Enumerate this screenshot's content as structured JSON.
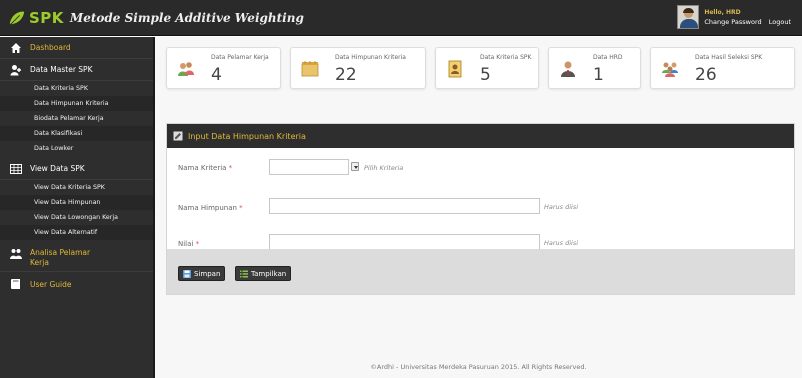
{
  "header": {
    "brand_spk": "SPK",
    "brand_rest": "Metode Simple Additive Weighting",
    "greeting": "Hello, HRD",
    "change_password": "Change Password",
    "logout": "Logout"
  },
  "sidebar": {
    "items": [
      {
        "label": "Dashboard",
        "icon": "home-icon",
        "active": true
      },
      {
        "label": "Data Master SPK",
        "icon": "add-user-icon"
      },
      {
        "label": "Data Kriteria SPK"
      },
      {
        "label": "Data Himpunan Kriteria"
      },
      {
        "label": "Biodata Pelamar Kerja"
      },
      {
        "label": "Data Klasifikasi"
      },
      {
        "label": "Data Lowker"
      },
      {
        "label": "View Data SPK",
        "icon": "table-icon"
      },
      {
        "label": "View Data Kriteria SPK"
      },
      {
        "label": "View Data Himpunan"
      },
      {
        "label": "View Data Lowongan Kerja"
      },
      {
        "label": "View Data Alternatif"
      },
      {
        "label": "Analisa Pelamar Kerja",
        "icon": "users-icon"
      },
      {
        "label": "User Guide",
        "icon": "book-icon"
      }
    ]
  },
  "stats": [
    {
      "label": "Data Pelamar Kerja",
      "value": "4",
      "icon": "people-icon"
    },
    {
      "label": "Data Himpunan Kriteria",
      "value": "22",
      "icon": "folder-icon"
    },
    {
      "label": "Data Kriteria SPK",
      "value": "5",
      "icon": "document-icon"
    },
    {
      "label": "Data HRD",
      "value": "1",
      "icon": "user-icon"
    },
    {
      "label": "Data Hasil Seleksi SPK",
      "value": "26",
      "icon": "group-icon"
    }
  ],
  "form": {
    "title": "Input Data Himpunan Kriteria",
    "nama_kriteria_label": "Nama Kriteria",
    "nama_kriteria_hint": "Pilih Kriteria",
    "nama_himpunan_label": "Nama Himpunan",
    "nama_himpunan_hint": "Harus diisi",
    "nilai_label": "Nilai",
    "nilai_hint": "Harus diisi",
    "required_mark": "*",
    "save_label": "Simpan",
    "show_label": "Tampilkan"
  },
  "footer": {
    "text": "©Ardhi - Universitas Merdeka Pasuruan 2015. All Rights Reserved."
  },
  "colors": {
    "header_bg": "#2a2a2a",
    "sidebar_bg": "#2e2e2e",
    "brand_green": "#9ccc2c",
    "accent_gold": "#e0b83a"
  }
}
